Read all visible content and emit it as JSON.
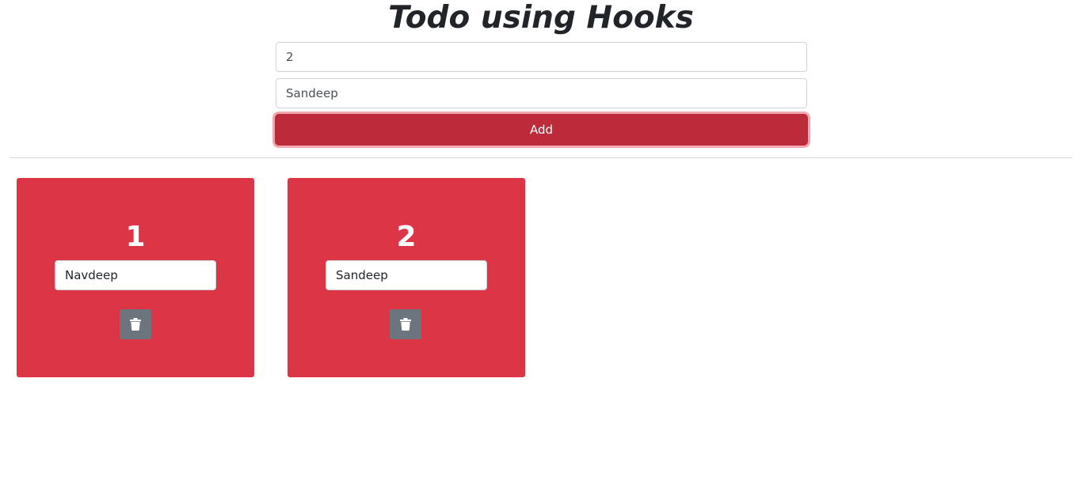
{
  "header": {
    "title": "Todo using Hooks"
  },
  "form": {
    "id_value": "2",
    "name_value": "Sandeep",
    "add_label": "Add"
  },
  "todos": [
    {
      "number": "1",
      "name": "Navdeep",
      "delete_icon": "trash-icon"
    },
    {
      "number": "2",
      "name": "Sandeep",
      "delete_icon": "trash-icon"
    }
  ],
  "colors": {
    "card": "#dc3545",
    "add_button": "#bd2a3a",
    "delete_button": "#6c757d"
  }
}
